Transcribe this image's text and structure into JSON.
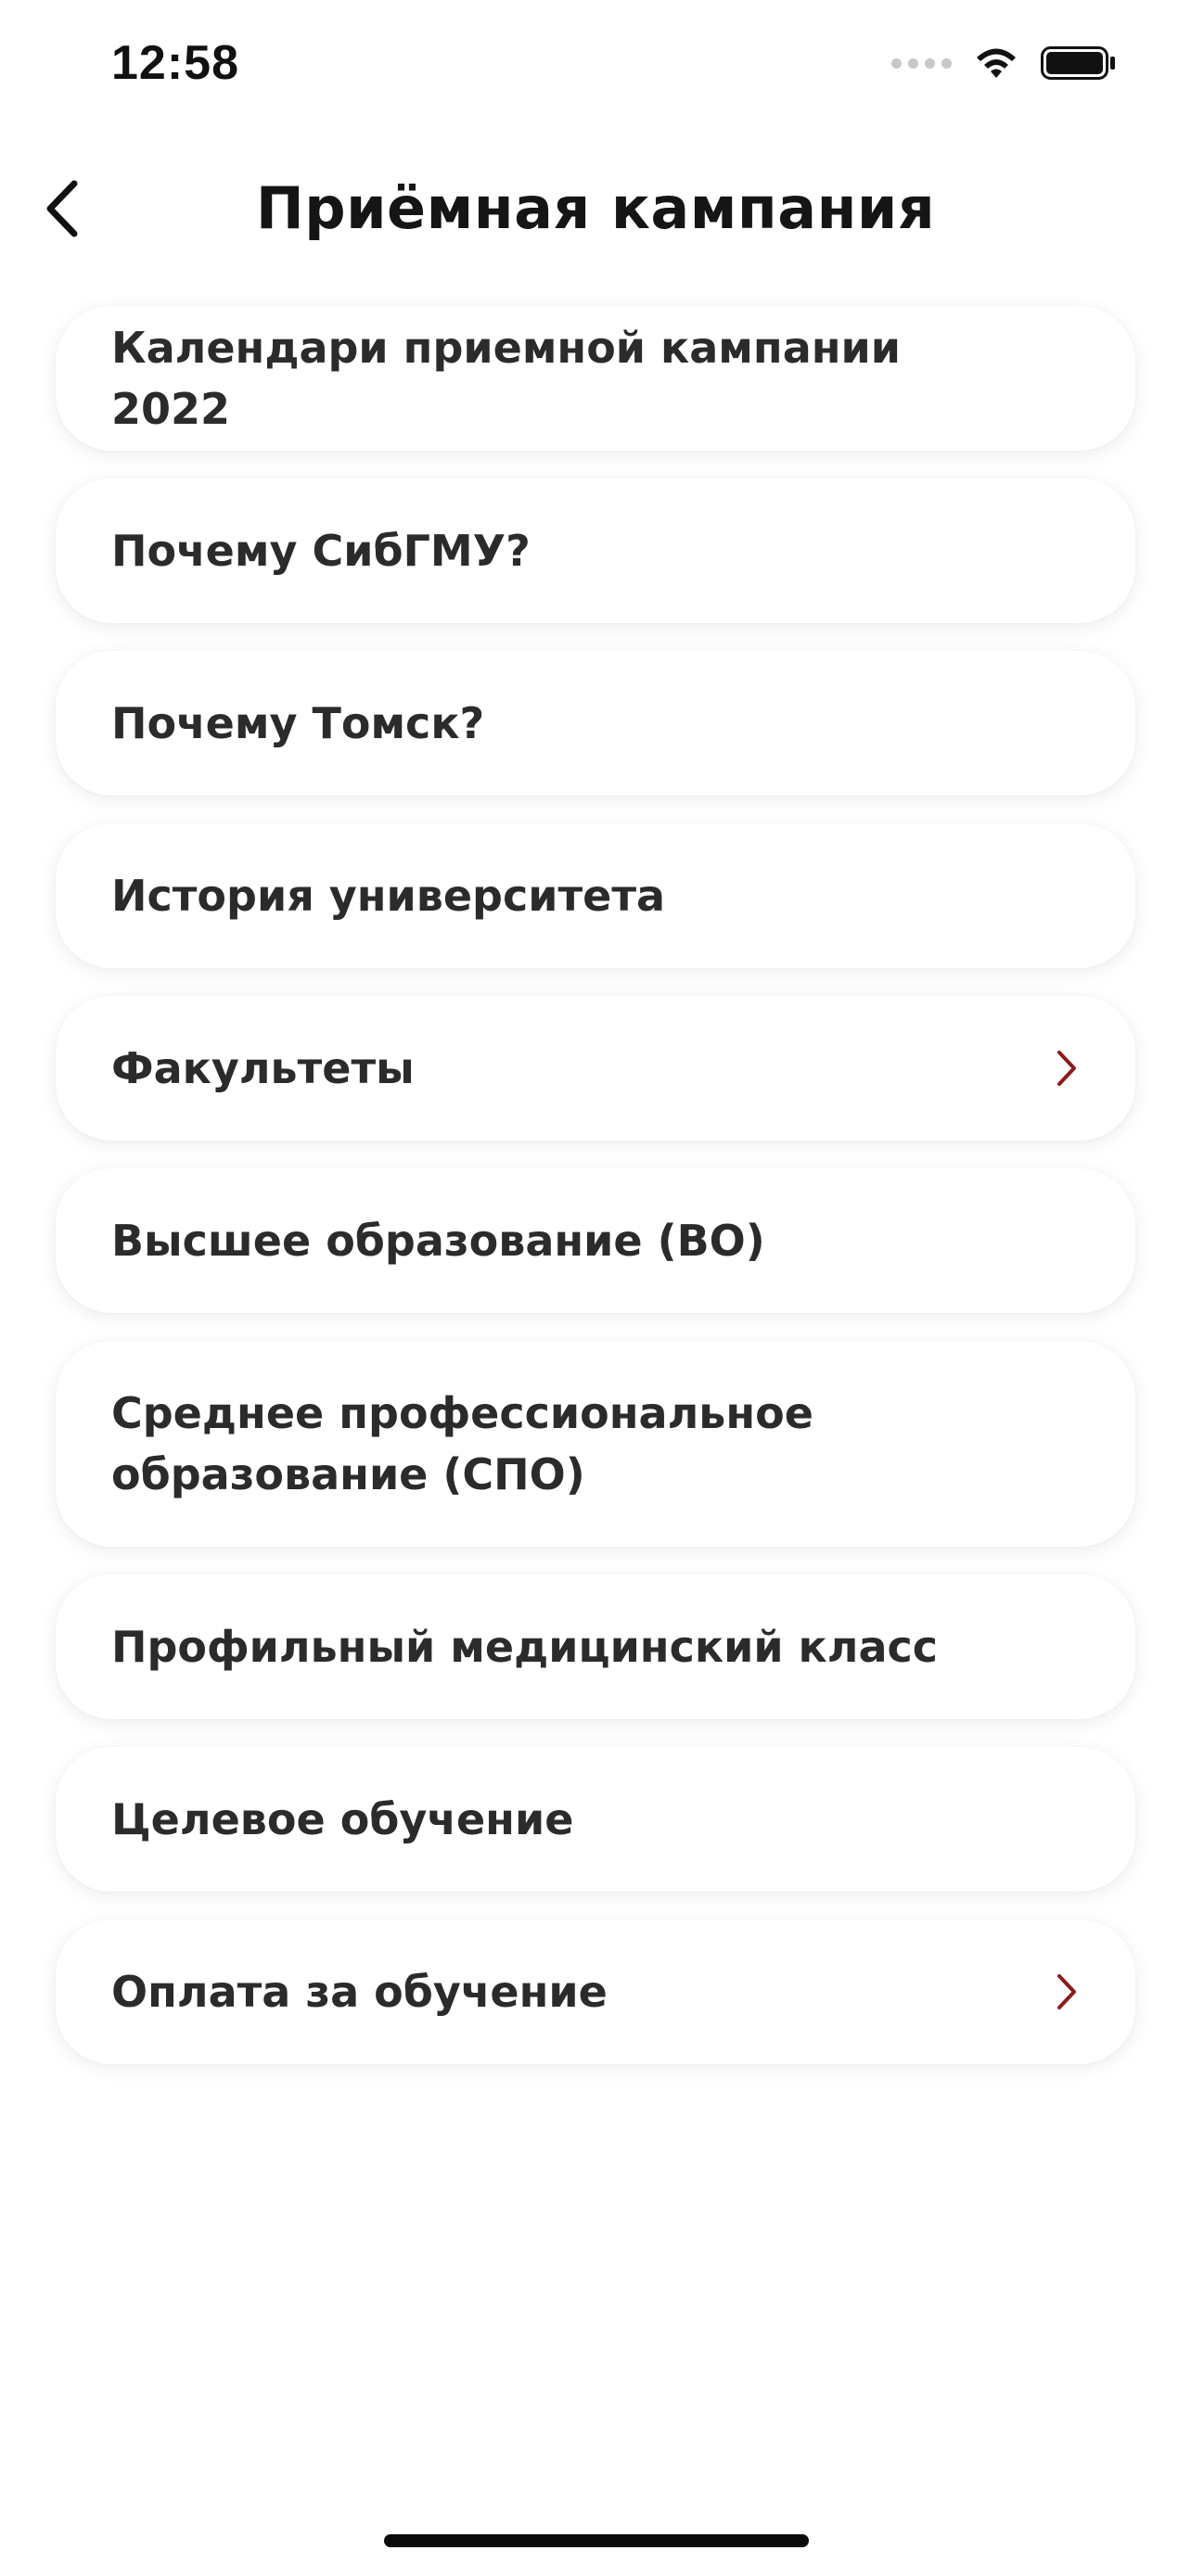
{
  "status_bar": {
    "time": "12:58",
    "icons": [
      "cellular-signal-icon",
      "wifi-icon",
      "battery-icon"
    ]
  },
  "header": {
    "back_icon": "chevron-left-icon",
    "title": "Приёмная кампания"
  },
  "menu": {
    "items": [
      {
        "label": "Календари приемной кампании 2022",
        "has_chevron": false
      },
      {
        "label": "Почему СибГМУ?",
        "has_chevron": false
      },
      {
        "label": "Почему Томск?",
        "has_chevron": false
      },
      {
        "label": "История университета",
        "has_chevron": false
      },
      {
        "label": "Факультеты",
        "has_chevron": true
      },
      {
        "label": "Высшее образование (ВО)",
        "has_chevron": false
      },
      {
        "label": "Среднее профессиональное\nобразование (СПО)",
        "has_chevron": false
      },
      {
        "label": "Профильный медицинский класс",
        "has_chevron": false
      },
      {
        "label": "Целевое обучение",
        "has_chevron": false
      },
      {
        "label": "Оплата за обучение",
        "has_chevron": true
      }
    ]
  },
  "colors": {
    "accent_chevron": "#8b1c1c",
    "text": "#2b2b2b",
    "background": "#ffffff"
  }
}
